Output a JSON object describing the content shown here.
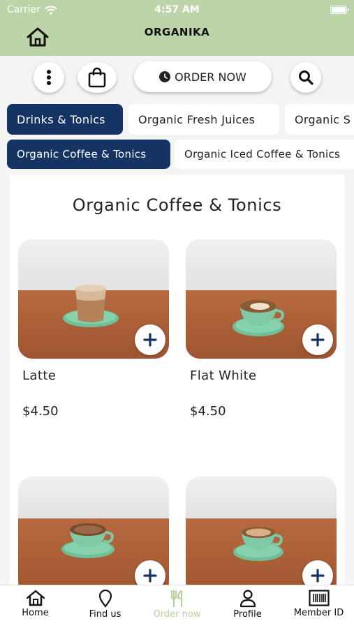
{
  "status_bar": {
    "carrier": "Carrier",
    "time": "4:57 AM"
  },
  "header": {
    "brand": "ORGANIKA"
  },
  "toolbar": {
    "order_now_label": "ORDER NOW"
  },
  "categories": [
    {
      "label": "Drinks & Tonics",
      "active": true
    },
    {
      "label": "Organic Fresh Juices",
      "active": false
    },
    {
      "label": "Organic S",
      "active": false
    }
  ],
  "subcategories": [
    {
      "label": "Organic Coffee & Tonics",
      "active": true
    },
    {
      "label": "Organic Iced Coffee & Tonics",
      "active": false
    }
  ],
  "section": {
    "title": "Organic Coffee & Tonics"
  },
  "products": [
    {
      "name": "Latte",
      "price": "$4.50"
    },
    {
      "name": "Flat White",
      "price": "$4.50"
    },
    {
      "name": "",
      "price": ""
    },
    {
      "name": "",
      "price": ""
    }
  ],
  "tabbar": {
    "items": [
      {
        "label": "Home",
        "icon": "home-icon"
      },
      {
        "label": "Find us",
        "icon": "location-pin-icon"
      },
      {
        "label": "Order now",
        "icon": "cutlery-icon"
      },
      {
        "label": "Profile",
        "icon": "user-icon"
      },
      {
        "label": "Member ID",
        "icon": "barcode-icon"
      }
    ]
  },
  "colors": {
    "header_bg": "#bdd4a8",
    "primary_navy": "#163463",
    "inactive_tab": "#b8cfa0"
  }
}
